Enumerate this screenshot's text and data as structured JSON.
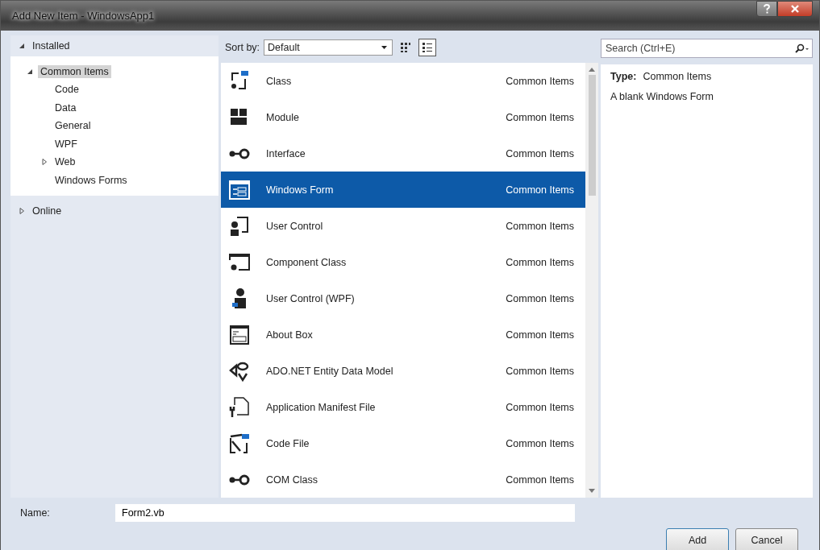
{
  "window": {
    "title": "Add New Item - WindowsApp1"
  },
  "tree": [
    {
      "label": "Installed",
      "expanded": true,
      "selected": false,
      "children": [
        {
          "label": "Common Items",
          "expanded": true,
          "selected": true,
          "children": [
            {
              "label": "Code",
              "selected": false
            },
            {
              "label": "Data",
              "selected": false
            },
            {
              "label": "General",
              "selected": false
            },
            {
              "label": "WPF",
              "selected": false
            },
            {
              "label": "Web",
              "selected": false,
              "expanded": false
            },
            {
              "label": "Windows Forms",
              "selected": false
            }
          ]
        }
      ]
    },
    {
      "label": "Online",
      "expanded": false,
      "selected": false
    }
  ],
  "toolbar": {
    "sort_label": "Sort by:",
    "sort_value": "Default",
    "view_buttons": [
      {
        "kind": "grid",
        "selected": false
      },
      {
        "kind": "list",
        "selected": true
      }
    ]
  },
  "search": {
    "placeholder": "Search (Ctrl+E)"
  },
  "items": [
    {
      "kind": "class",
      "name": "Class",
      "category": "Common Items",
      "selected": false
    },
    {
      "kind": "module",
      "name": "Module",
      "category": "Common Items",
      "selected": false
    },
    {
      "kind": "interface",
      "name": "Interface",
      "category": "Common Items",
      "selected": false
    },
    {
      "kind": "form",
      "name": "Windows Form",
      "category": "Common Items",
      "selected": true
    },
    {
      "kind": "usercontrol",
      "name": "User Control",
      "category": "Common Items",
      "selected": false
    },
    {
      "kind": "component",
      "name": "Component Class",
      "category": "Common Items",
      "selected": false
    },
    {
      "kind": "wpfcontrol",
      "name": "User Control (WPF)",
      "category": "Common Items",
      "selected": false
    },
    {
      "kind": "about",
      "name": "About Box",
      "category": "Common Items",
      "selected": false
    },
    {
      "kind": "entity",
      "name": "ADO.NET Entity Data Model",
      "category": "Common Items",
      "selected": false
    },
    {
      "kind": "manifest",
      "name": "Application Manifest File",
      "category": "Common Items",
      "selected": false
    },
    {
      "kind": "codefile",
      "name": "Code File",
      "category": "Common Items",
      "selected": false
    },
    {
      "kind": "interface",
      "name": "COM Class",
      "category": "Common Items",
      "selected": false
    }
  ],
  "details": {
    "type_label": "Type:",
    "type_value": "Common Items",
    "description": "A blank Windows Form"
  },
  "name_field": {
    "label": "Name:",
    "value": "Form2.vb"
  },
  "buttons": [
    "Add",
    "Cancel"
  ]
}
